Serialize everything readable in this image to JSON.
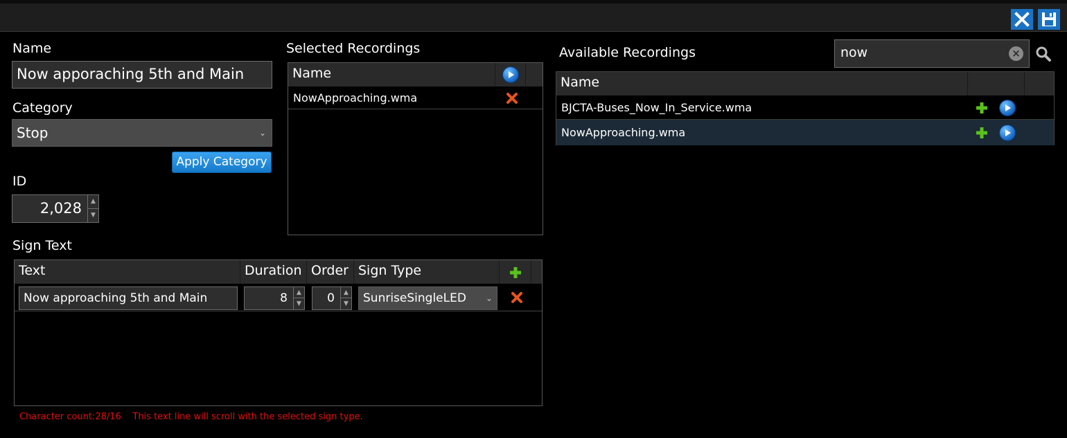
{
  "toolbar": {
    "close_icon": "close-icon",
    "save_icon": "save-icon",
    "accent": "#1a72c4"
  },
  "form": {
    "name_label": "Name",
    "name_value": "Now apporaching 5th and Main",
    "category_label": "Category",
    "category_value": "Stop",
    "apply_label": "Apply Category",
    "id_label": "ID",
    "id_value": "2,028"
  },
  "selected": {
    "title": "Selected Recordings",
    "header_name": "Name",
    "rows": [
      {
        "name": "NowApproaching.wma"
      }
    ]
  },
  "sign_text": {
    "title": "Sign Text",
    "headers": {
      "text": "Text",
      "duration": "Duration",
      "order": "Order",
      "sign_type": "Sign Type"
    },
    "rows": [
      {
        "text": "Now approaching 5th and Main",
        "duration": "8",
        "order": "0",
        "sign_type": "SunriseSingleLED"
      }
    ]
  },
  "status": {
    "char_count": "Character count:28/16",
    "message": "This text line will scroll with the selected sign type.",
    "color": "#e01010"
  },
  "available": {
    "title": "Available Recordings",
    "search_value": "now",
    "header_name": "Name",
    "rows": [
      {
        "name": "BJCTA-Buses_Now_In_Service.wma"
      },
      {
        "name": "NowApproaching.wma"
      }
    ],
    "selected_row_color": "#1b2a36"
  }
}
